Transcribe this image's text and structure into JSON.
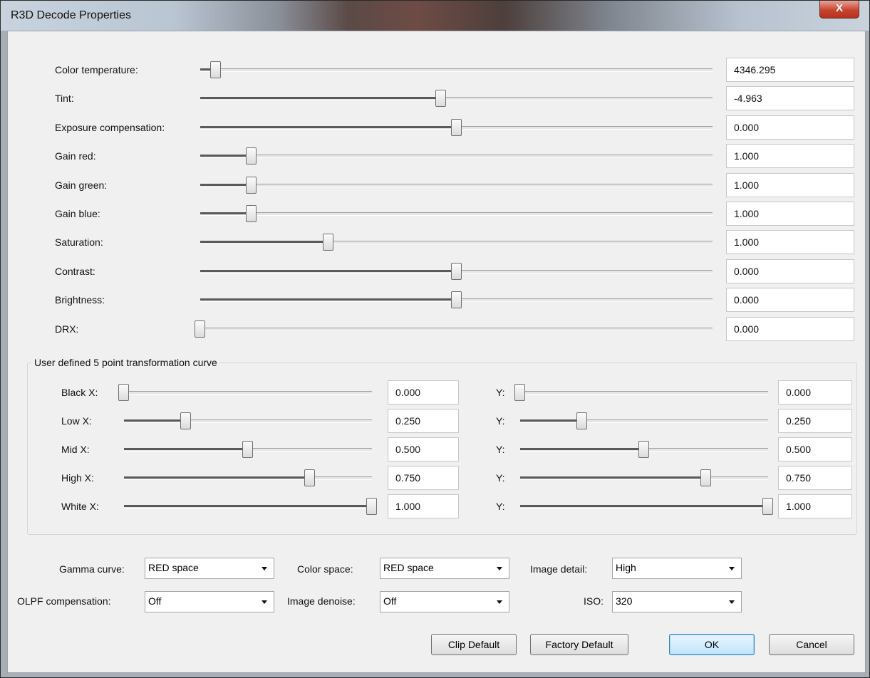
{
  "window": {
    "title": "R3D Decode Properties",
    "close_label": "X"
  },
  "sliders": [
    {
      "label": "Color temperature:",
      "value": "4346.295",
      "fraction": 0.03
    },
    {
      "label": "Tint:",
      "value": "-4.963",
      "fraction": 0.47
    },
    {
      "label": "Exposure compensation:",
      "value": "0.000",
      "fraction": 0.5
    },
    {
      "label": "Gain red:",
      "value": "1.000",
      "fraction": 0.1
    },
    {
      "label": "Gain green:",
      "value": "1.000",
      "fraction": 0.1
    },
    {
      "label": "Gain blue:",
      "value": "1.000",
      "fraction": 0.1
    },
    {
      "label": "Saturation:",
      "value": "1.000",
      "fraction": 0.25
    },
    {
      "label": "Contrast:",
      "value": "0.000",
      "fraction": 0.5
    },
    {
      "label": "Brightness:",
      "value": "0.000",
      "fraction": 0.5
    },
    {
      "label": "DRX:",
      "value": "0.000",
      "fraction": 0.0
    }
  ],
  "curve": {
    "title": "User defined 5 point transformation curve",
    "y_label": "Y:",
    "points": [
      {
        "label": "Black X:",
        "x_value": "0.000",
        "x_fraction": 0.0,
        "y_value": "0.000",
        "y_fraction": 0.0
      },
      {
        "label": "Low X:",
        "x_value": "0.250",
        "x_fraction": 0.25,
        "y_value": "0.250",
        "y_fraction": 0.25
      },
      {
        "label": "Mid X:",
        "x_value": "0.500",
        "x_fraction": 0.5,
        "y_value": "0.500",
        "y_fraction": 0.5
      },
      {
        "label": "High X:",
        "x_value": "0.750",
        "x_fraction": 0.75,
        "y_value": "0.750",
        "y_fraction": 0.75
      },
      {
        "label": "White X:",
        "x_value": "1.000",
        "x_fraction": 1.0,
        "y_value": "1.000",
        "y_fraction": 1.0
      }
    ]
  },
  "dropdowns": {
    "gamma_curve": {
      "label": "Gamma curve:",
      "value": "RED space"
    },
    "color_space": {
      "label": "Color space:",
      "value": "RED space"
    },
    "image_detail": {
      "label": "Image detail:",
      "value": "High"
    },
    "olpf": {
      "label": "OLPF compensation:",
      "value": "Off"
    },
    "image_denoise": {
      "label": "Image denoise:",
      "value": "Off"
    },
    "iso": {
      "label": "ISO:",
      "value": "320"
    }
  },
  "buttons": {
    "clip_default": "Clip Default",
    "factory_default": "Factory Default",
    "ok": "OK",
    "cancel": "Cancel"
  }
}
